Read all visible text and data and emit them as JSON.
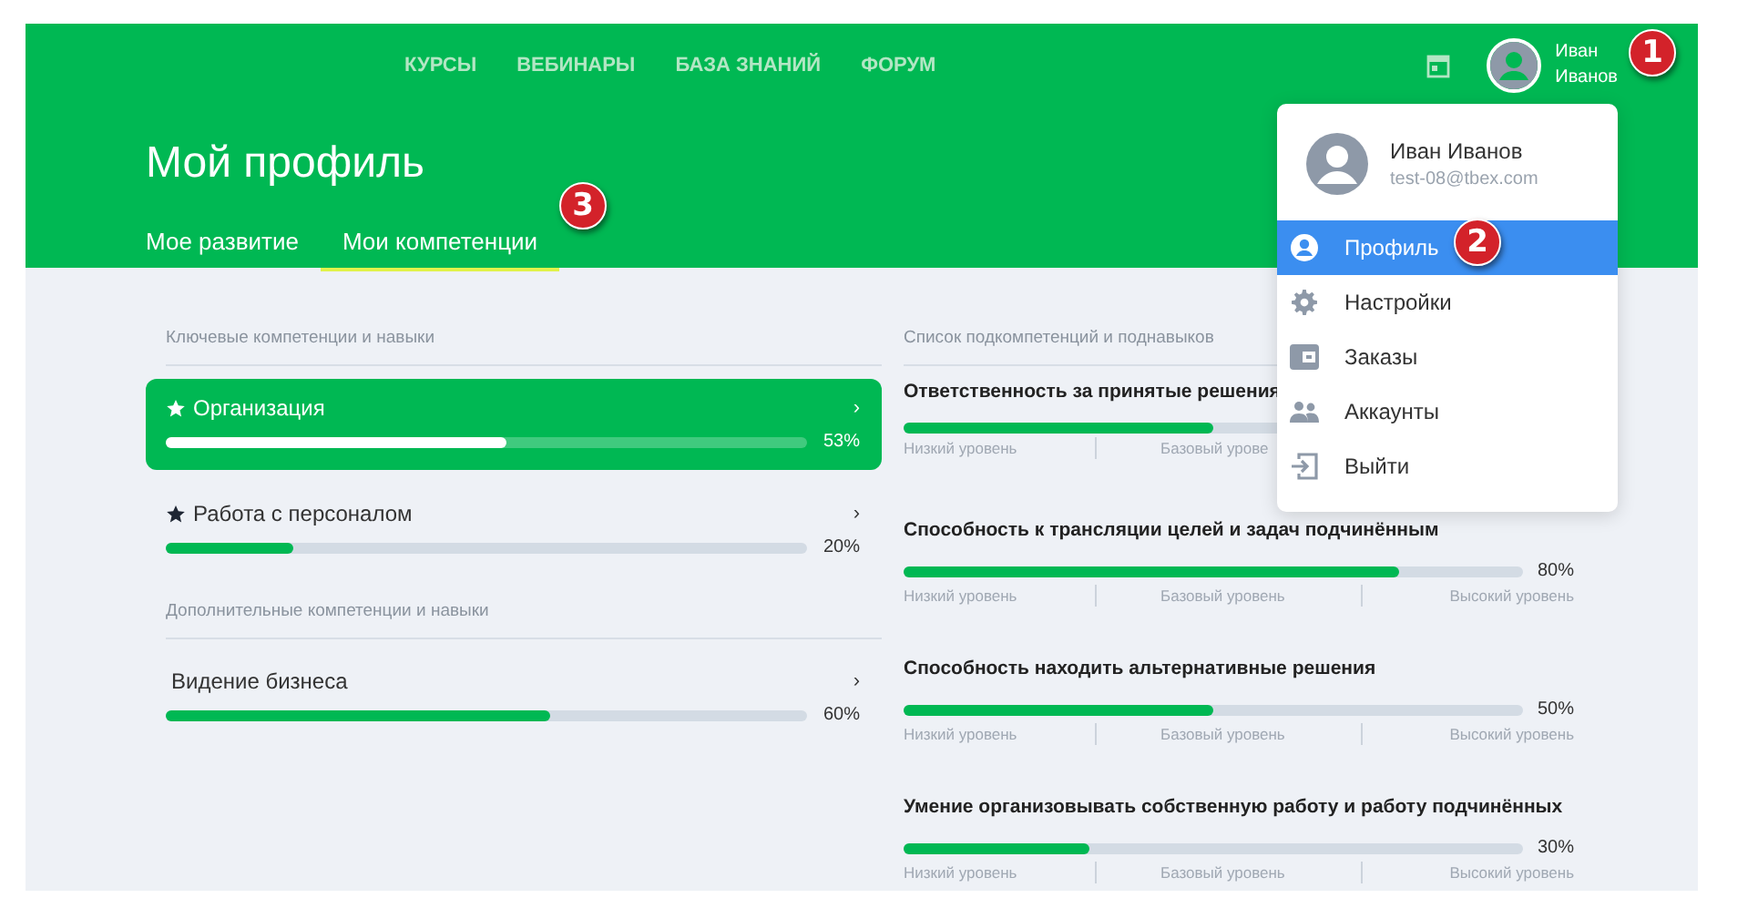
{
  "nav": {
    "links": [
      "КУРСЫ",
      "ВЕБИНАРЫ",
      "БАЗА ЗНАНИЙ",
      "ФОРУМ"
    ],
    "user_name_lines": [
      "Иван",
      "Иванов"
    ]
  },
  "page_title": "Мой профиль",
  "tabs": [
    {
      "label": "Мое развитие",
      "selected": false
    },
    {
      "label": "Мои компетенции",
      "selected": true
    }
  ],
  "key_section": {
    "heading": "Ключевые компетенции и навыки",
    "items": [
      {
        "name": "Организация",
        "starred": true,
        "selected": true,
        "level": 0.53,
        "percent": "53%",
        "chevron": "›"
      },
      {
        "name": "Работа с персоналом",
        "starred": true,
        "selected": false,
        "level": 0.2,
        "percent": "20%",
        "chevron": "›"
      }
    ]
  },
  "extra_section": {
    "heading": "Дополнительные компетенции и навыки",
    "items": [
      {
        "name": "Видение бизнеса",
        "starred": false,
        "selected": false,
        "level": 0.6,
        "percent": "60%",
        "chevron": "›"
      }
    ]
  },
  "subs": {
    "heading": "Список подкомпетенций и поднавыков",
    "items": [
      {
        "title": "Ответственность за принятые решения",
        "level": 0.5,
        "labels": [
          "Низкий уровень",
          "Базовый урове"
        ]
      },
      {
        "title": "Способность к трансляции целей и задач подчинённым",
        "level": 0.8,
        "percent": "80%",
        "labels": [
          "Низкий уровень",
          "Базовый уровень",
          "Высокий уровень"
        ]
      },
      {
        "title": "Способность находить альтернативные решения",
        "level": 0.5,
        "percent": "50%",
        "labels": [
          "Низкий уровень",
          "Базовый уровень",
          "Высокий уровень"
        ]
      },
      {
        "title": "Умение организовывать собственную работу и работу подчинённых",
        "level": 0.3,
        "percent": "30%",
        "labels": [
          "Низкий уровень",
          "Базовый уровень",
          "Высокий уровень"
        ]
      }
    ]
  },
  "user_menu": {
    "name": "Иван Иванов",
    "email": "test-08@tbex.com",
    "items": [
      {
        "label": "Профиль",
        "kind": "person",
        "selected": true
      },
      {
        "label": "Настройки",
        "kind": "gear",
        "selected": false
      },
      {
        "label": "Заказы",
        "kind": "wallet",
        "selected": false
      },
      {
        "label": "Аккаунты",
        "kind": "people",
        "selected": false
      },
      {
        "label": "Выйти",
        "kind": "logout",
        "selected": false
      }
    ]
  },
  "annotations": [
    {
      "number": "1"
    },
    {
      "number": "2"
    },
    {
      "number": "3"
    }
  ]
}
